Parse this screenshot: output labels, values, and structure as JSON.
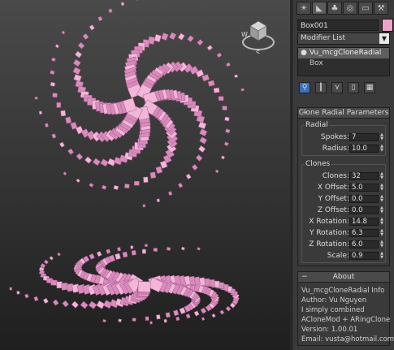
{
  "toolbar_tabs": [
    {
      "icon": "create-icon",
      "glyph": "☀"
    },
    {
      "icon": "modify-icon",
      "glyph": "◣"
    },
    {
      "icon": "hierarchy-icon",
      "glyph": "♣"
    },
    {
      "icon": "motion-icon",
      "glyph": "◎"
    },
    {
      "icon": "display-icon",
      "glyph": "▭"
    },
    {
      "icon": "utilities-icon",
      "glyph": "⚒"
    }
  ],
  "object": {
    "name": "Box001",
    "color": "#f0a3c9"
  },
  "modifier_list": {
    "label": "Modifier List"
  },
  "modifier_stack": [
    {
      "label": "Vu_mcgCloneRadial",
      "selected": true
    },
    {
      "label": "Box",
      "selected": false
    }
  ],
  "stack_tools": [
    {
      "icon": "pin-stack-icon",
      "glyph": "⚲"
    },
    {
      "icon": "show-end-result-icon",
      "glyph": "┃"
    },
    {
      "icon": "make-unique-icon",
      "glyph": "⋎"
    },
    {
      "icon": "remove-modifier-icon",
      "glyph": "▯"
    },
    {
      "icon": "configure-modifier-sets-icon",
      "glyph": "▦"
    }
  ],
  "clone_radial": {
    "title": "Clone Radial Parameters",
    "radial_group": "Radial",
    "spokes": {
      "label": "Spokes:",
      "value": "7"
    },
    "radius": {
      "label": "Radius:",
      "value": "10.0"
    },
    "clones_group": "Clones",
    "clones": {
      "label": "Clones:",
      "value": "32"
    },
    "x_offset": {
      "label": "X Offset:",
      "value": "5.0"
    },
    "y_offset": {
      "label": "Y Offset:",
      "value": "0.0"
    },
    "z_offset": {
      "label": "Z Offset:",
      "value": "0.0"
    },
    "x_rotation": {
      "label": "X Rotation:",
      "value": "14.8"
    },
    "y_rotation": {
      "label": "Y Rotation:",
      "value": "6.3"
    },
    "z_rotation": {
      "label": "Z Rotation:",
      "value": "6.0"
    },
    "scale": {
      "label": "Scale:",
      "value": "0.9"
    }
  },
  "about": {
    "title": "About",
    "lines": [
      "Vu_mcgCloneRadial Info",
      "Author: Vu Nguyen",
      "I simply combined",
      "ACloneMod + ARingClone",
      "Version: 1.00.01",
      "Email: vusta@hotmail.com"
    ]
  },
  "viewcube": {
    "compass_w": "W",
    "compass_s": "S"
  },
  "colors": {
    "tentacle": "#d98bbd",
    "tentacle_light": "#f2b6d8",
    "tentacle_dark": "#a45c8a",
    "accent": "#3a6fb8"
  }
}
